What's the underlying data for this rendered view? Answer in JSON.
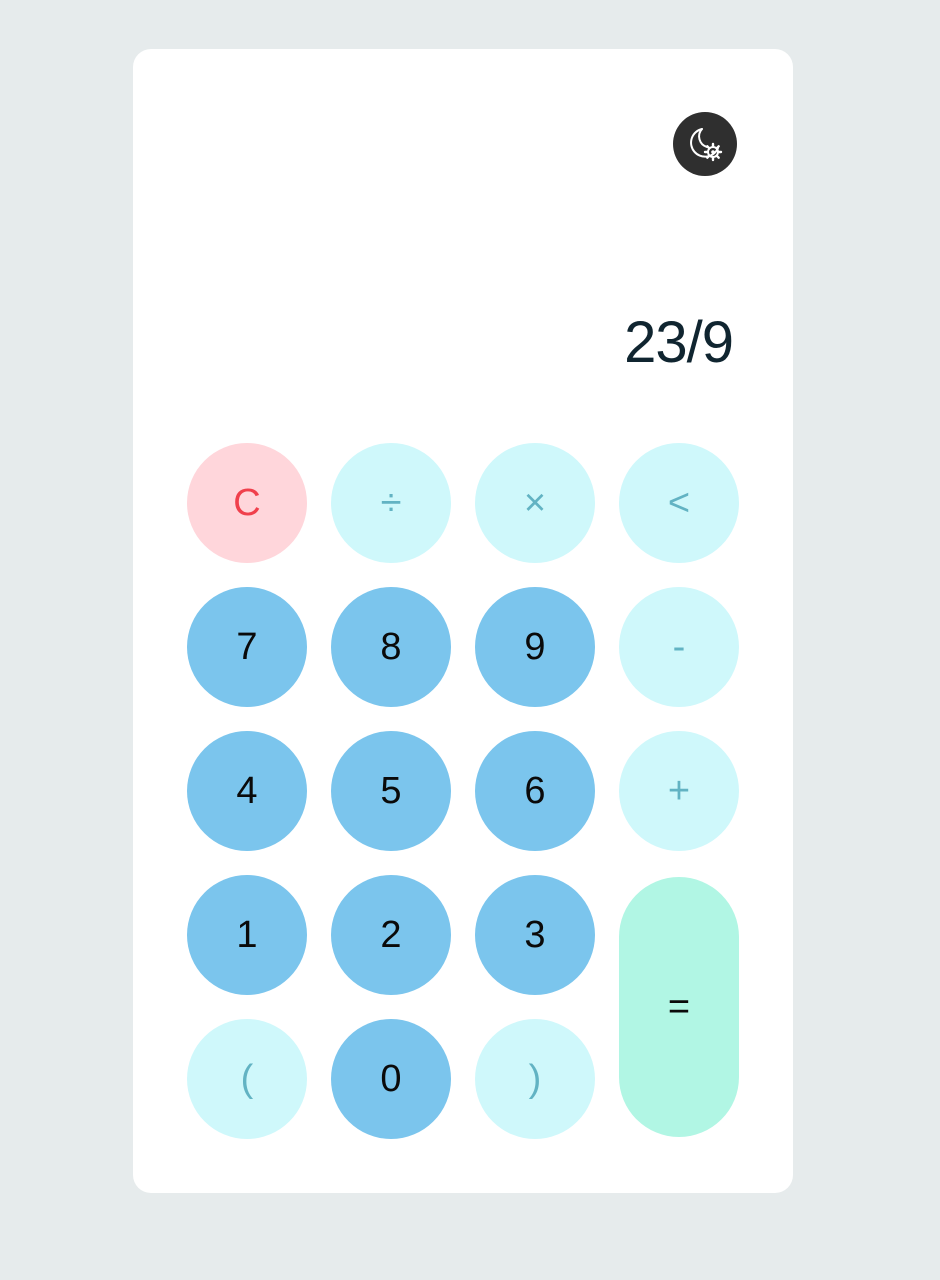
{
  "display": {
    "expression": "23/9"
  },
  "theme_toggle": {
    "icon": "moon-gear-icon",
    "icon_bg": "#2f2f2f"
  },
  "keys": {
    "clear": "C",
    "divide": "÷",
    "multiply": "×",
    "backspace": "<",
    "seven": "7",
    "eight": "8",
    "nine": "9",
    "minus": "-",
    "four": "4",
    "five": "5",
    "six": "6",
    "plus": "+",
    "one": "1",
    "two": "2",
    "three": "3",
    "equals": "=",
    "open_paren": "(",
    "zero": "0",
    "close_paren": ")"
  },
  "colors": {
    "page_bg": "#e6ebec",
    "card_bg": "#ffffff",
    "clear_bg": "#ffd6db",
    "clear_text": "#f0404c",
    "operator_bg": "#cff8fb",
    "operator_text": "#62b3c3",
    "number_bg": "#7bc5ed",
    "equals_bg": "#b1f6e4",
    "display_text": "#102530"
  }
}
